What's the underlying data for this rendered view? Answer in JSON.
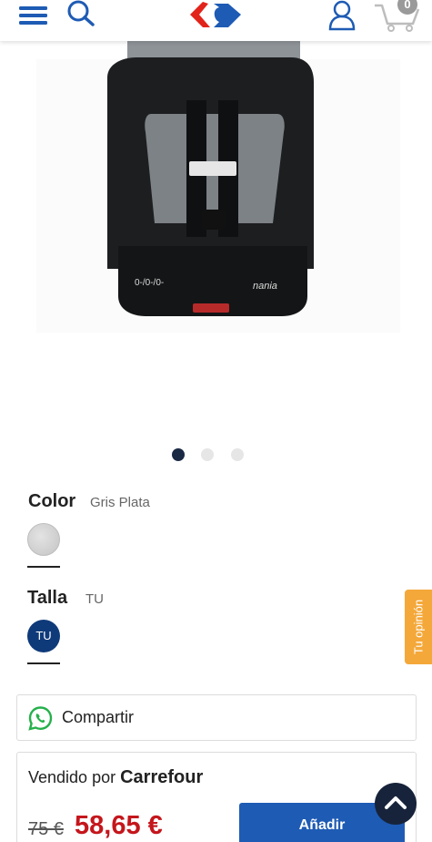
{
  "header": {
    "cart_count": "0",
    "icons": [
      "menu-icon",
      "search-icon",
      "carrefour-logo",
      "account-icon",
      "cart-icon"
    ]
  },
  "gallery": {
    "image": "child car seat (grey and black)",
    "brand_text_on_image": "nania",
    "dot_count": 3,
    "active_index": 0
  },
  "attributes": {
    "color_label": "Color",
    "color_value": "Gris Plata",
    "color_swatch": "#cfcfcf",
    "size_label": "Talla",
    "size_value": "TU",
    "size_swatch_label": "TU",
    "size_swatch_color": "#0f3a7a"
  },
  "feedback_tab": "Tu opinión",
  "share": {
    "label": "Compartir",
    "icon": "whatsapp-icon"
  },
  "seller": {
    "prefix": "Vendido por",
    "name": "Carrefour",
    "old_price": "75 €",
    "new_price": "58,65 €",
    "add_button": "Añadir"
  },
  "colors": {
    "primary": "#1e5bb4",
    "price_red": "#c4161c",
    "dark_navy": "#17233a",
    "feedback_orange": "#f4a83a"
  }
}
